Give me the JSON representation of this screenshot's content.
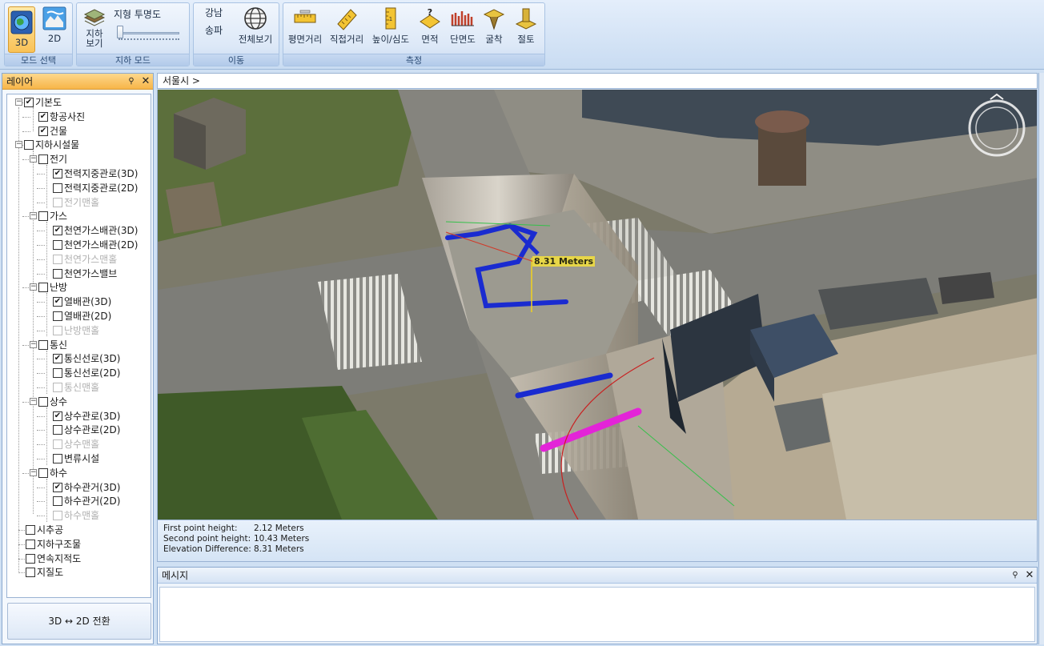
{
  "ribbon": {
    "mode_group": {
      "label": "모드 선택",
      "btn_3d": "3D",
      "btn_2d": "2D"
    },
    "underground_group": {
      "label": "지하 모드",
      "view_btn_line1": "지하",
      "view_btn_line2": "보기",
      "transparency_label": "지형 투명도",
      "transparency_level": 0.0
    },
    "move_group": {
      "label": "이동",
      "link_gangnam": "강남",
      "link_songpa": "송파",
      "full_view": "전체보기"
    },
    "measure_group": {
      "label": "측정",
      "tools": [
        "평면거리",
        "직접거리",
        "높이/심도",
        "면적",
        "단면도",
        "굴착",
        "절토"
      ]
    }
  },
  "layer_panel": {
    "title": "레이어",
    "pin_icon": "pin-icon",
    "close_icon": "close-icon",
    "switch_button": "3D ↔ 2D 전환",
    "items": [
      {
        "label": "기본도",
        "checked": true,
        "disabled": false,
        "level": 0,
        "expander": "-"
      },
      {
        "label": "항공사진",
        "checked": true,
        "disabled": false,
        "level": 1,
        "expander": ""
      },
      {
        "label": "건물",
        "checked": true,
        "disabled": false,
        "level": 1,
        "expander": ""
      },
      {
        "label": "지하시설물",
        "checked": false,
        "disabled": false,
        "level": 0,
        "expander": "-"
      },
      {
        "label": "전기",
        "checked": false,
        "disabled": false,
        "level": 1,
        "expander": "-"
      },
      {
        "label": "전력지중관로(3D)",
        "checked": true,
        "disabled": false,
        "level": 2,
        "expander": ""
      },
      {
        "label": "전력지중관로(2D)",
        "checked": false,
        "disabled": false,
        "level": 2,
        "expander": ""
      },
      {
        "label": "전기맨홀",
        "checked": false,
        "disabled": true,
        "level": 2,
        "expander": ""
      },
      {
        "label": "가스",
        "checked": false,
        "disabled": false,
        "level": 1,
        "expander": "-"
      },
      {
        "label": "천연가스배관(3D)",
        "checked": true,
        "disabled": false,
        "level": 2,
        "expander": ""
      },
      {
        "label": "천연가스배관(2D)",
        "checked": false,
        "disabled": false,
        "level": 2,
        "expander": ""
      },
      {
        "label": "천연가스맨홀",
        "checked": false,
        "disabled": true,
        "level": 2,
        "expander": ""
      },
      {
        "label": "천연가스밸브",
        "checked": false,
        "disabled": false,
        "level": 2,
        "expander": ""
      },
      {
        "label": "난방",
        "checked": false,
        "disabled": false,
        "level": 1,
        "expander": "-"
      },
      {
        "label": "열배관(3D)",
        "checked": true,
        "disabled": false,
        "level": 2,
        "expander": ""
      },
      {
        "label": "열배관(2D)",
        "checked": false,
        "disabled": false,
        "level": 2,
        "expander": ""
      },
      {
        "label": "난방맨홀",
        "checked": false,
        "disabled": true,
        "level": 2,
        "expander": ""
      },
      {
        "label": "통신",
        "checked": false,
        "disabled": false,
        "level": 1,
        "expander": "-"
      },
      {
        "label": "통신선로(3D)",
        "checked": true,
        "disabled": false,
        "level": 2,
        "expander": ""
      },
      {
        "label": "통신선로(2D)",
        "checked": false,
        "disabled": false,
        "level": 2,
        "expander": ""
      },
      {
        "label": "통신맨홀",
        "checked": false,
        "disabled": true,
        "level": 2,
        "expander": ""
      },
      {
        "label": "상수",
        "checked": false,
        "disabled": false,
        "level": 1,
        "expander": "-"
      },
      {
        "label": "상수관로(3D)",
        "checked": true,
        "disabled": false,
        "level": 2,
        "expander": ""
      },
      {
        "label": "상수관로(2D)",
        "checked": false,
        "disabled": false,
        "level": 2,
        "expander": ""
      },
      {
        "label": "상수맨홀",
        "checked": false,
        "disabled": true,
        "level": 2,
        "expander": ""
      },
      {
        "label": "변류시설",
        "checked": false,
        "disabled": false,
        "level": 2,
        "expander": ""
      },
      {
        "label": "하수",
        "checked": false,
        "disabled": false,
        "level": 1,
        "expander": "-"
      },
      {
        "label": "하수관거(3D)",
        "checked": true,
        "disabled": false,
        "level": 2,
        "expander": ""
      },
      {
        "label": "하수관거(2D)",
        "checked": false,
        "disabled": false,
        "level": 2,
        "expander": ""
      },
      {
        "label": "하수맨홀",
        "checked": false,
        "disabled": true,
        "level": 2,
        "expander": ""
      },
      {
        "label": "시추공",
        "checked": false,
        "disabled": false,
        "level": 0,
        "expander": ""
      },
      {
        "label": "지하구조물",
        "checked": false,
        "disabled": false,
        "level": 0,
        "expander": ""
      },
      {
        "label": "연속지적도",
        "checked": false,
        "disabled": false,
        "level": 0,
        "expander": ""
      },
      {
        "label": "지질도",
        "checked": false,
        "disabled": false,
        "level": 0,
        "expander": ""
      }
    ]
  },
  "breadcrumb": "서울시 >",
  "map": {
    "measure_label": "8.31 Meters",
    "compass_icon": "compass-icon"
  },
  "measurement": {
    "rows": [
      {
        "key": "First point height:",
        "value": "2.12 Meters"
      },
      {
        "key": "Second point height:",
        "value": "10.43 Meters"
      },
      {
        "key": "Elevation Difference:",
        "value": "8.31 Meters"
      }
    ]
  },
  "message_panel": {
    "title": "메시지"
  },
  "colors": {
    "pipe_blue": "#1a2bd0",
    "pipe_magenta": "#e324d8",
    "panel_header": "#f7b548",
    "ribbon_active": "#f9c257"
  }
}
